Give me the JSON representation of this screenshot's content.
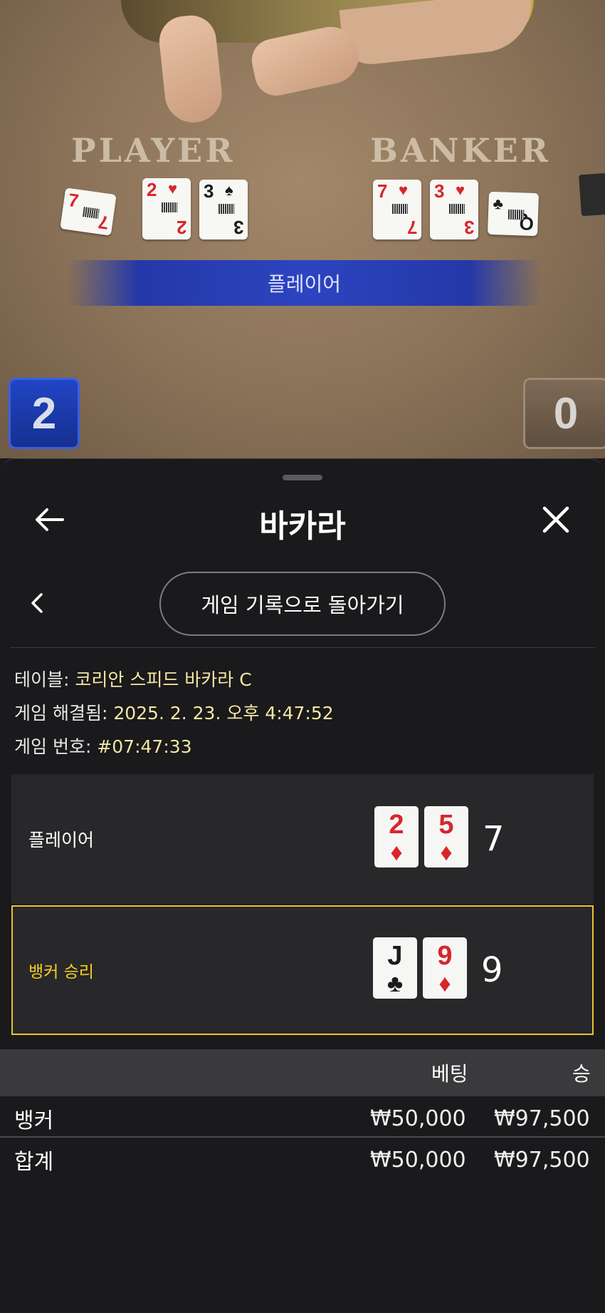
{
  "video": {
    "table_labels": {
      "player": "PLAYER",
      "banker": "BANKER"
    },
    "player_cards": [
      {
        "rank": "7",
        "suit": "♦",
        "color": "red"
      },
      {
        "rank": "2",
        "suit": "♥",
        "color": "red"
      },
      {
        "rank": "3",
        "suit": "♠",
        "color": "black"
      }
    ],
    "banker_cards": [
      {
        "rank": "7",
        "suit": "♥",
        "color": "red"
      },
      {
        "rank": "3",
        "suit": "♥",
        "color": "red"
      },
      {
        "rank": "Q",
        "suit": "♣",
        "color": "black"
      }
    ],
    "winner_banner": "플레이어",
    "player_score": "2",
    "banker_score": "0"
  },
  "sheet": {
    "title": "바카라",
    "back_to_history": "게임 기록으로 돌아가기",
    "info": {
      "table_label": "테이블: ",
      "table_value": "코리안 스피드 바카라 C",
      "resolved_label": "게임 해결됨: ",
      "resolved_value": "2025. 2. 23. 오후 4:47:52",
      "round_label": "게임 번호: ",
      "round_value": "#07:47:33"
    },
    "result": {
      "player": {
        "label": "플레이어",
        "cards": [
          {
            "rank": "2",
            "suit": "♦"
          },
          {
            "rank": "5",
            "suit": "♦"
          }
        ],
        "total": "7"
      },
      "banker": {
        "label": "뱅커 승리",
        "cards": [
          {
            "rank": "J",
            "suit": "♣"
          },
          {
            "rank": "9",
            "suit": "♦"
          }
        ],
        "total": "9"
      }
    },
    "bets": {
      "headers": {
        "bet": "베팅",
        "win": "승"
      },
      "rows": [
        {
          "name": "뱅커",
          "bet": "₩50,000",
          "win": "₩97,500"
        }
      ],
      "total": {
        "name": "합계",
        "bet": "₩50,000",
        "win": "₩97,500"
      }
    }
  },
  "colors": {
    "accent_yellow": "#f3d11e",
    "info_value": "#f3e7a6",
    "player_blue": "#2c44c0"
  }
}
